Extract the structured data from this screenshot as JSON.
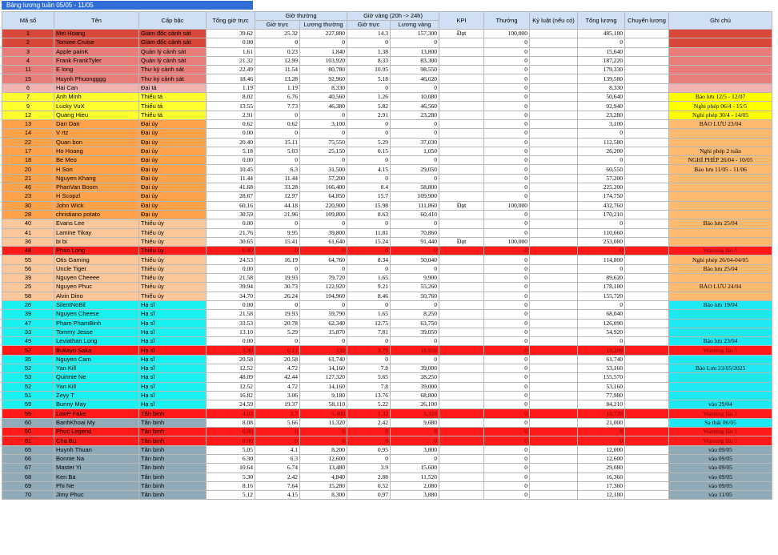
{
  "title": "Bảng lương tuần 05/05 - 11/05",
  "headers": {
    "ma_so": "Mã số",
    "ten": "Tên",
    "cap_bac": "Cấp bậc",
    "tong_gio_truc": "Tổng giờ trực",
    "gio_thuong": "Giờ thường",
    "gio_vang": "Giờ vàng (20h -> 24h)",
    "gio_truc": "Giờ trực",
    "luong_thuong": "Lương thường",
    "luong_vang": "Lương vàng",
    "kpi": "KPI",
    "thuong": "Thưởng",
    "ky_luat": "Kỷ luật (nếu có)",
    "tong_luong": "Tổng lương",
    "chuyen_luong": "Chuyển lương",
    "ghi_chu": "Ghi chú"
  },
  "colors": {
    "dark_red": "#d9473b",
    "red": "#e87d79",
    "pink": "#f2b3b3",
    "yellow": "#ffff2e",
    "orange": "#ffa24a",
    "peach": "#fbc79b",
    "bright_red": "#ff1a1a",
    "cyan": "#19f0f0",
    "grey": "#90aab8",
    "note_yellow": "#ffff00",
    "note_orange": "#ffba72",
    "note_cyan": "#1fe8f5"
  },
  "rows": [
    [
      "1",
      "Mei Hoang",
      "Giám đốc cảnh sát",
      "39.62",
      "25.32",
      "227,880",
      "14.3",
      "157,300",
      "Đạt",
      "100,000",
      "",
      "485,180",
      "",
      "",
      "dark_red",
      "dark_red"
    ],
    [
      "2",
      "Tomiee Cruise",
      "Giám đốc cảnh sát",
      "0.00",
      "0",
      "0",
      "0",
      "0",
      "",
      "0",
      "",
      "0",
      "",
      "",
      "dark_red",
      "dark_red"
    ],
    [
      "3",
      "Apple painK",
      "Quản lý cảnh sát",
      "1.61",
      "0.23",
      "1,840",
      "1.38",
      "13,800",
      "",
      "0",
      "",
      "15,640",
      "",
      "",
      "red",
      "red"
    ],
    [
      "4",
      "Frank FrankTyler",
      "Quản lý cảnh sát",
      "21.32",
      "12.99",
      "103,920",
      "8.33",
      "83,300",
      "",
      "0",
      "",
      "187,220",
      "",
      "",
      "red",
      "red"
    ],
    [
      "11",
      "E long",
      "Thư ký cảnh sát",
      "22.49",
      "11.54",
      "80,780",
      "10.95",
      "98,550",
      "",
      "0",
      "",
      "179,330",
      "",
      "",
      "red",
      "red"
    ],
    [
      "15",
      "Huynh Phuongggg",
      "Thư ký cảnh sát",
      "18.46",
      "13.28",
      "92,960",
      "5.18",
      "46,620",
      "",
      "0",
      "",
      "139,580",
      "",
      "",
      "red",
      "red"
    ],
    [
      "6",
      "Hai Can",
      "Đại tá",
      "1.19",
      "1.19",
      "8,330",
      "0",
      "0",
      "",
      "0",
      "",
      "8,330",
      "",
      "",
      "pink",
      "pink"
    ],
    [
      "7",
      "Anh Minh",
      "Thiếu tá",
      "8.02",
      "6.76",
      "40,560",
      "1.26",
      "10,080",
      "",
      "0",
      "",
      "50,640",
      "",
      "Bảo lưu 12/5  - 12/07",
      "yellow",
      "note_yellow"
    ],
    [
      "9",
      "Lucky VuX",
      "Thiếu tá",
      "13.55",
      "7.73",
      "46,380",
      "5.82",
      "46,560",
      "",
      "0",
      "",
      "92,940",
      "",
      "Nghỉ phép 06/4 - 15/5",
      "yellow",
      "note_yellow"
    ],
    [
      "12",
      "Quang Hieu",
      "Thiếu tá",
      "2.91",
      "0",
      "0",
      "2.91",
      "23,280",
      "",
      "0",
      "",
      "23,280",
      "",
      "Nghỉ phép 30/4 - 14/05",
      "yellow",
      "note_yellow"
    ],
    [
      "13",
      "Dan Dan",
      "Đại úy",
      "0.62",
      "0.62",
      "3,100",
      "0",
      "0",
      "",
      "0",
      "",
      "3,100",
      "",
      "BẢO LƯU 23/04",
      "orange",
      "note_orange"
    ],
    [
      "14",
      "V rtz",
      "Đại úy",
      "0.00",
      "0",
      "0",
      "0",
      "0",
      "",
      "0",
      "",
      "0",
      "",
      "",
      "orange",
      "note_orange"
    ],
    [
      "22",
      "Quan bon",
      "Đại úy",
      "20.40",
      "15.11",
      "75,550",
      "5.29",
      "37,030",
      "",
      "0",
      "",
      "112,580",
      "",
      "",
      "orange",
      "note_orange"
    ],
    [
      "17",
      "Ho Hoang",
      "Đại úy",
      "5.18",
      "5.03",
      "25,150",
      "0.15",
      "1,050",
      "",
      "0",
      "",
      "26,200",
      "",
      "Nghỉ phép 2 tuần",
      "orange",
      "note_orange"
    ],
    [
      "18",
      "Be Meo",
      "Đại úy",
      "0.00",
      "0",
      "0",
      "0",
      "0",
      "",
      "0",
      "",
      "0",
      "",
      "NGHỈ PHÉP 26/04 - 10/05",
      "orange",
      "note_orange"
    ],
    [
      "20",
      "H Son",
      "Đại úy",
      "10.45",
      "6.3",
      "31,500",
      "4.15",
      "29,050",
      "",
      "0",
      "",
      "60,550",
      "",
      "Bảo lưu 11/05 - 11/06",
      "orange",
      "note_orange"
    ],
    [
      "21",
      "Nguyen Khang",
      "Đại úy",
      "11.44",
      "11.44",
      "57,200",
      "0",
      "0",
      "",
      "0",
      "",
      "57,200",
      "",
      "",
      "orange",
      "note_orange"
    ],
    [
      "46",
      "PhanVan Boom",
      "Đại úy",
      "41.68",
      "33.28",
      "166,400",
      "8.4",
      "58,800",
      "",
      "0",
      "",
      "225,200",
      "",
      "",
      "orange",
      "note_orange"
    ],
    [
      "23",
      "H Scopzl",
      "Đại úy",
      "28.67",
      "12.97",
      "64,850",
      "15.7",
      "109,900",
      "",
      "0",
      "",
      "174,750",
      "",
      "",
      "orange",
      "note_orange"
    ],
    [
      "30",
      "John Wick",
      "Đại úy",
      "60.16",
      "44.18",
      "220,900",
      "15.98",
      "111,860",
      "Đạt",
      "100,000",
      "",
      "432,760",
      "",
      "",
      "orange",
      "note_orange"
    ],
    [
      "28",
      "christiano potato",
      "Đại úy",
      "30.59",
      "21.96",
      "109,800",
      "8.63",
      "60,410",
      "",
      "0",
      "",
      "170,210",
      "",
      "",
      "orange",
      "note_orange"
    ],
    [
      "40",
      "Evans Lee",
      "Thiếu úy",
      "0.00",
      "0",
      "0",
      "0",
      "0",
      "",
      "0",
      "",
      "0",
      "",
      "Bảo lưu 25/04",
      "peach",
      "note_orange"
    ],
    [
      "41",
      "Lamine Tikay",
      "Thiếu úy",
      "21.76",
      "9.95",
      "39,800",
      "11.81",
      "70,860",
      "",
      "0",
      "",
      "110,660",
      "",
      "",
      "peach",
      "note_orange"
    ],
    [
      "36",
      "bi bi",
      "Thiếu úy",
      "30.65",
      "15.41",
      "61,640",
      "15.24",
      "91,440",
      "Đạt",
      "100,000",
      "",
      "253,080",
      "",
      "",
      "peach",
      "note_orange"
    ],
    [
      "48",
      "Phan Long",
      "Thiếu úy",
      "0.00",
      "0",
      "0",
      "0",
      "0",
      "",
      "0",
      "",
      "0",
      "",
      "Warning lần 1",
      "bright_red",
      "bright_red"
    ],
    [
      "55",
      "Otis Gaming",
      "Thiếu úy",
      "24.53",
      "16.19",
      "64,760",
      "8.34",
      "50,040",
      "",
      "0",
      "",
      "114,800",
      "",
      "Nghỉ phép 26/04-04/05",
      "peach",
      "note_orange"
    ],
    [
      "56",
      "Uncle Tiger",
      "Thiếu úy",
      "0.00",
      "0",
      "0",
      "0",
      "0",
      "",
      "0",
      "",
      "0",
      "",
      "Bảo lưu 25/04",
      "peach",
      "note_orange"
    ],
    [
      "39",
      "Nguyen Cheeee",
      "Thiếu úy",
      "21.58",
      "19.93",
      "79,720",
      "1.65",
      "9,900",
      "",
      "0",
      "",
      "89,620",
      "",
      "",
      "peach",
      "note_orange"
    ],
    [
      "25",
      "Nguyen Phuc",
      "Thiếu úy",
      "39.94",
      "30.73",
      "122,920",
      "9.21",
      "55,260",
      "",
      "0",
      "",
      "178,180",
      "",
      "BẢO LƯU 24/04",
      "peach",
      "note_orange"
    ],
    [
      "58",
      "Alvin Dino",
      "Thiếu úy",
      "34.70",
      "26.24",
      "104,960",
      "8.46",
      "50,760",
      "",
      "0",
      "",
      "155,720",
      "",
      "",
      "peach",
      "note_orange"
    ],
    [
      "26",
      "SilentNoBil",
      "Hạ sĩ",
      "0.00",
      "0",
      "0",
      "0",
      "0",
      "",
      "0",
      "",
      "0",
      "",
      "Bảo lưu 19/04",
      "cyan",
      "note_cyan"
    ],
    [
      "39",
      "Nguyen Cheese",
      "Hạ sĩ",
      "21.58",
      "19.93",
      "59,790",
      "1.65",
      "8,250",
      "",
      "0",
      "",
      "68,040",
      "",
      "",
      "cyan",
      "note_cyan"
    ],
    [
      "47",
      "Pham PhamBinh",
      "Hạ sĩ",
      "33.53",
      "20.78",
      "62,340",
      "12.75",
      "63,750",
      "",
      "0",
      "",
      "126,090",
      "",
      "",
      "cyan",
      "note_cyan"
    ],
    [
      "33",
      "Tommy Jesse",
      "Hạ sĩ",
      "13.10",
      "5.29",
      "15,870",
      "7.81",
      "39,050",
      "",
      "0",
      "",
      "54,920",
      "",
      "",
      "cyan",
      "note_cyan"
    ],
    [
      "49",
      "Leviathan Long",
      "Hạ sĩ",
      "0.00",
      "0",
      "0",
      "0",
      "0",
      "",
      "0",
      "",
      "0",
      "",
      "Bảo lưu 23/04",
      "cyan",
      "note_cyan"
    ],
    [
      "57",
      "Bukayo Saka",
      "Hạ sĩ",
      "3.90",
      "0.11",
      "330",
      "3.79",
      "18,950",
      "",
      "0",
      "",
      "19,280",
      "",
      "Warning lần 1",
      "bright_red",
      "bright_red"
    ],
    [
      "35",
      "Nguyen Cam",
      "Hạ sĩ",
      "20.58",
      "20.58",
      "61,740",
      "0",
      "0",
      "",
      "0",
      "",
      "61,740",
      "",
      "",
      "cyan",
      "note_cyan"
    ],
    [
      "52",
      "Yan Kill",
      "Hạ sĩ",
      "12.52",
      "4.72",
      "14,160",
      "7.8",
      "39,000",
      "",
      "0",
      "",
      "53,160",
      "",
      "Bảo Lưu 23/05/2025",
      "cyan",
      "note_cyan"
    ],
    [
      "53",
      "Quinnie Ne",
      "Hạ sĩ",
      "48.09",
      "42.44",
      "127,320",
      "5.65",
      "28,250",
      "",
      "0",
      "",
      "155,570",
      "",
      "",
      "cyan",
      "note_cyan"
    ],
    [
      "52",
      "Yan Kill",
      "Hạ sĩ",
      "12.52",
      "4.72",
      "14,160",
      "7.8",
      "39,000",
      "",
      "0",
      "",
      "53,160",
      "",
      "",
      "cyan",
      "note_cyan"
    ],
    [
      "51",
      "Zeyy T",
      "Hạ sĩ",
      "16.82",
      "3.06",
      "9,180",
      "13.76",
      "68,800",
      "",
      "0",
      "",
      "77,980",
      "",
      "",
      "cyan",
      "note_cyan"
    ],
    [
      "59",
      "Bunny May",
      "Hạ sĩ",
      "24.59",
      "19.37",
      "58,110",
      "5.22",
      "26,100",
      "",
      "0",
      "",
      "84,210",
      "",
      "vào 29/04",
      "cyan",
      "note_cyan"
    ],
    [
      "55",
      "LowP Fake",
      "Tân binh",
      "4.03",
      "2.7",
      "5,400",
      "1.33",
      "5,320",
      "",
      "0",
      "",
      "10,720",
      "",
      "Warning lần 1",
      "bright_red",
      "bright_red"
    ],
    [
      "60",
      "BanhKhoai My",
      "Tân binh",
      "8.08",
      "5.66",
      "11,320",
      "2.42",
      "9,680",
      "",
      "0",
      "",
      "21,000",
      "",
      "Sa thải 06/05",
      "grey",
      "note_cyan"
    ],
    [
      "50",
      "Phuc Legend",
      "Tân binh",
      "0.00",
      "0",
      "0",
      "0",
      "0",
      "",
      "0",
      "",
      "0",
      "",
      "Warning lần 1",
      "bright_red",
      "bright_red"
    ],
    [
      "61",
      "Cha Bu",
      "Tân binh",
      "0.00",
      "0",
      "0",
      "0",
      "0",
      "",
      "0",
      "",
      "0",
      "",
      "Warning lần 1",
      "bright_red",
      "bright_red"
    ],
    [
      "65",
      "Huynh Thuan",
      "Tân binh",
      "5.05",
      "4.1",
      "8,200",
      "0.95",
      "3,800",
      "",
      "0",
      "",
      "12,000",
      "",
      "vào 09/05",
      "grey",
      "grey"
    ],
    [
      "66",
      "Bonnie Na",
      "Tân binh",
      "6.30",
      "6.3",
      "12,600",
      "0",
      "0",
      "",
      "0",
      "",
      "12,600",
      "",
      "vào 09/05",
      "grey",
      "grey"
    ],
    [
      "67",
      "Master Yi",
      "Tân binh",
      "10.64",
      "6.74",
      "13,480",
      "3.9",
      "15,600",
      "",
      "0",
      "",
      "29,080",
      "",
      "vào 09/05",
      "grey",
      "grey"
    ],
    [
      "68",
      "Ken Ba",
      "Tân binh",
      "5.30",
      "2.42",
      "4,840",
      "2.88",
      "11,520",
      "",
      "0",
      "",
      "16,360",
      "",
      "vào 09/05",
      "grey",
      "grey"
    ],
    [
      "69",
      "Phi Ne",
      "Tân binh",
      "8.16",
      "7.64",
      "15,280",
      "0.52",
      "2,080",
      "",
      "0",
      "",
      "17,360",
      "",
      "vào 09/05",
      "grey",
      "grey"
    ],
    [
      "70",
      "Jimy Phuc",
      "Tân binh",
      "5.12",
      "4.15",
      "8,300",
      "0.97",
      "3,880",
      "",
      "0",
      "",
      "12,180",
      "",
      "vào 11/05",
      "grey",
      "grey"
    ]
  ]
}
